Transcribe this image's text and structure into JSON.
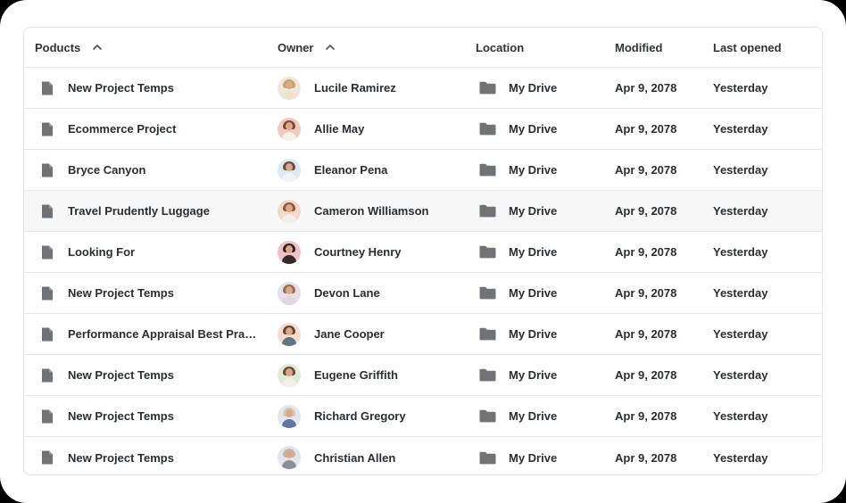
{
  "table": {
    "columns": {
      "name": "Poducts",
      "owner": "Owner",
      "location": "Location",
      "modified": "Modified",
      "last_opened": "Last opened"
    },
    "sort_icon": "chevron-up-icon",
    "rows": [
      {
        "name": "New Project Temps",
        "owner": "Lucile Ramirez",
        "location": "My Drive",
        "modified": "Apr 9, 2078",
        "last_opened": "Yesterday"
      },
      {
        "name": "Ecommerce Project",
        "owner": "Allie May",
        "location": "My Drive",
        "modified": "Apr 9, 2078",
        "last_opened": "Yesterday"
      },
      {
        "name": "Bryce Canyon",
        "owner": "Eleanor Pena",
        "location": "My Drive",
        "modified": "Apr 9, 2078",
        "last_opened": "Yesterday"
      },
      {
        "name": "Travel Prudently Luggage",
        "owner": "Cameron Williamson",
        "location": "My Drive",
        "modified": "Apr 9, 2078",
        "last_opened": "Yesterday"
      },
      {
        "name": "Looking For",
        "owner": "Courtney Henry",
        "location": "My Drive",
        "modified": "Apr 9, 2078",
        "last_opened": "Yesterday"
      },
      {
        "name": "New Project Temps",
        "owner": "Devon Lane",
        "location": "My Drive",
        "modified": "Apr 9, 2078",
        "last_opened": "Yesterday"
      },
      {
        "name": "Performance Appraisal Best Prac...",
        "owner": "Jane Cooper",
        "location": "My Drive",
        "modified": "Apr 9, 2078",
        "last_opened": "Yesterday"
      },
      {
        "name": "New Project Temps",
        "owner": "Eugene Griffith",
        "location": "My Drive",
        "modified": "Apr 9, 2078",
        "last_opened": "Yesterday"
      },
      {
        "name": "New Project Temps",
        "owner": "Richard Gregory",
        "location": "My Drive",
        "modified": "Apr 9, 2078",
        "last_opened": "Yesterday"
      },
      {
        "name": "New Project Temps",
        "owner": "Christian Allen",
        "location": "My Drive",
        "modified": "Apr 9, 2078",
        "last_opened": "Yesterday"
      }
    ]
  },
  "icons": {
    "file": "file-icon",
    "folder": "folder-icon",
    "avatar": "avatar"
  },
  "colors": {
    "icon_gray": "#6f7277",
    "text": "#2a2d33",
    "border": "#e3e4e6",
    "hover_row": "#f7f7f8"
  },
  "avatars": [
    {
      "bg": "#efe7db",
      "hair": "#c9a36a",
      "body": "#efe3cf"
    },
    {
      "bg": "#f1c9bd",
      "hair": "#7a4a33",
      "body": "#f4f1ec"
    },
    {
      "bg": "#dce9f3",
      "hair": "#6a4a38",
      "body": "#f3f3f3"
    },
    {
      "bg": "#f6d8c9",
      "hair": "#8b5a3c",
      "body": "#f2eee9"
    },
    {
      "bg": "#f2c1c7",
      "hair": "#2e211d",
      "body": "#352a27"
    },
    {
      "bg": "#e7e0ec",
      "hair": "#9a6b4a",
      "body": "#e0d7e3"
    },
    {
      "bg": "#f4ddcf",
      "hair": "#5f4430",
      "body": "#617386"
    },
    {
      "bg": "#ddecd9",
      "hair": "#6b4a32",
      "body": "#f2efe9"
    },
    {
      "bg": "#e3e5ef",
      "hair": "#d8c7b2",
      "body": "#6077a1"
    },
    {
      "bg": "#e6e3f0",
      "hair": "#c8b5a0",
      "body": "#8d8f98"
    }
  ]
}
